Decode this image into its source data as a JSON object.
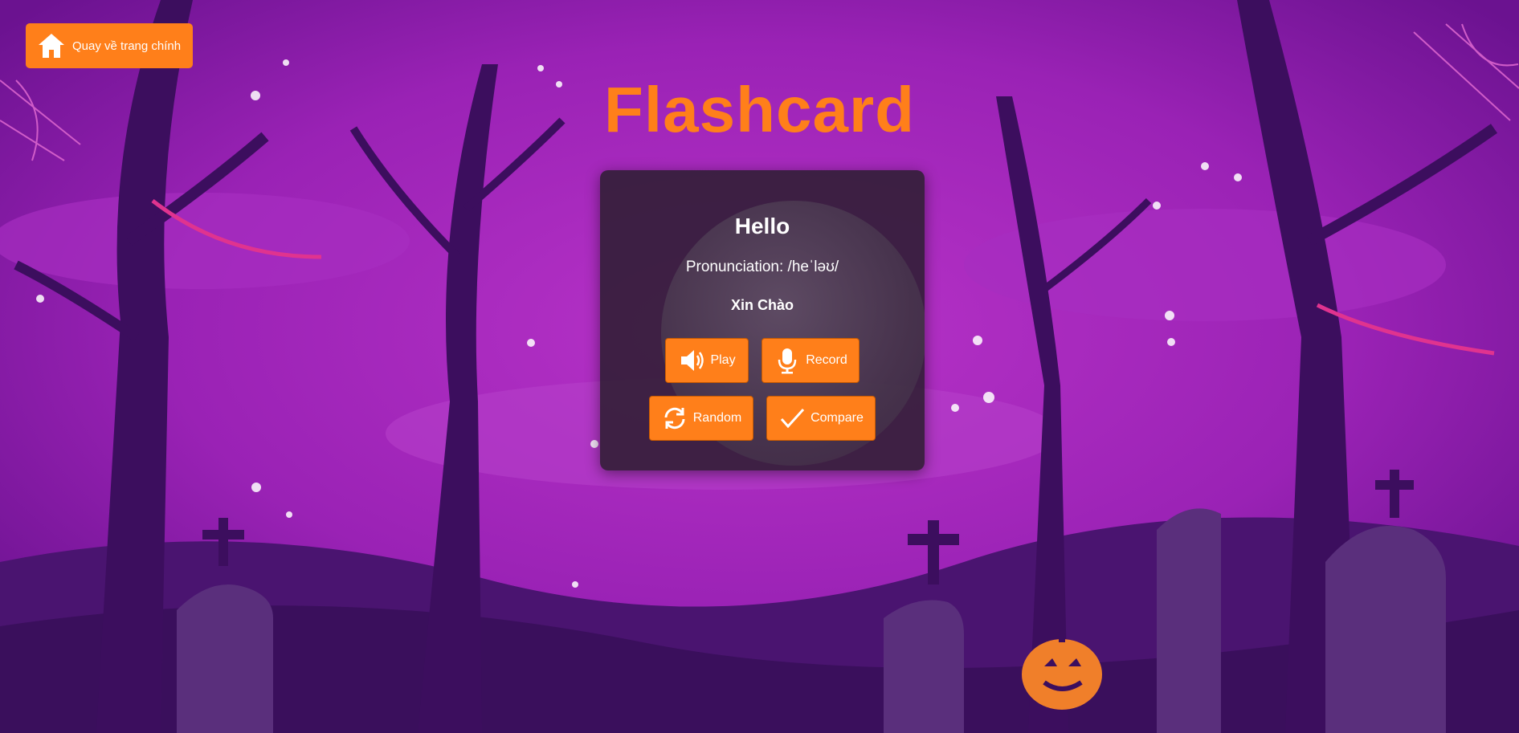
{
  "home_button": {
    "label": "Quay về trang chính",
    "icon": "home-icon"
  },
  "title": "Flashcard",
  "card": {
    "word": "Hello",
    "pronunciation": "Pronunciation: /heˈləʊ/",
    "meaning": "Xin Chào"
  },
  "buttons": {
    "play": {
      "label": "Play",
      "icon": "speaker-icon"
    },
    "record": {
      "label": "Record",
      "icon": "microphone-icon"
    },
    "random": {
      "label": "Random",
      "icon": "refresh-icon"
    },
    "compare": {
      "label": "Compare",
      "icon": "checkmark-icon"
    }
  },
  "colors": {
    "accent": "#ff7f1a",
    "background": "#8a1aa8",
    "card": "#2d1e32"
  }
}
